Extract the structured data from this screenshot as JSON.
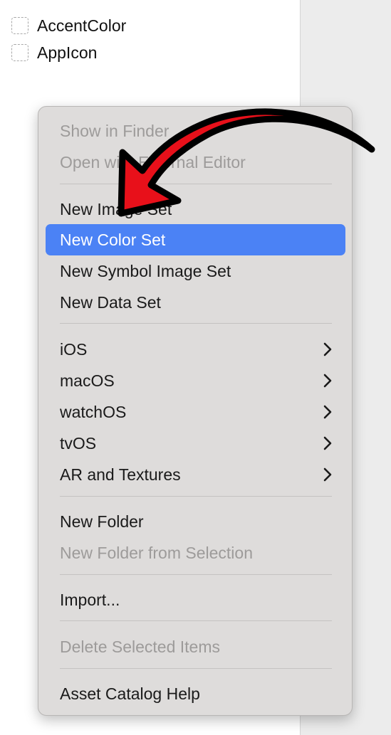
{
  "asset_list": {
    "items": [
      {
        "label": "AccentColor"
      },
      {
        "label": "AppIcon"
      }
    ]
  },
  "context_menu": {
    "show_in_finder": "Show in Finder",
    "open_external_editor": "Open with External Editor",
    "new_image_set": "New Image Set",
    "new_color_set": "New Color Set",
    "new_symbol_image_set": "New Symbol Image Set",
    "new_data_set": "New Data Set",
    "ios": "iOS",
    "macos": "macOS",
    "watchos": "watchOS",
    "tvos": "tvOS",
    "ar_textures": "AR and Textures",
    "new_folder": "New Folder",
    "new_folder_from_selection": "New Folder from Selection",
    "import": "Import...",
    "delete_selected": "Delete Selected Items",
    "help": "Asset Catalog Help",
    "highlighted_item": "New Color Set",
    "submenu_icon": "chevron-right-icon"
  },
  "colors": {
    "highlight": "#4b82f5",
    "menu_background": "#dedcdb",
    "arrow_fill": "#e8101a",
    "arrow_outline": "#000000"
  }
}
